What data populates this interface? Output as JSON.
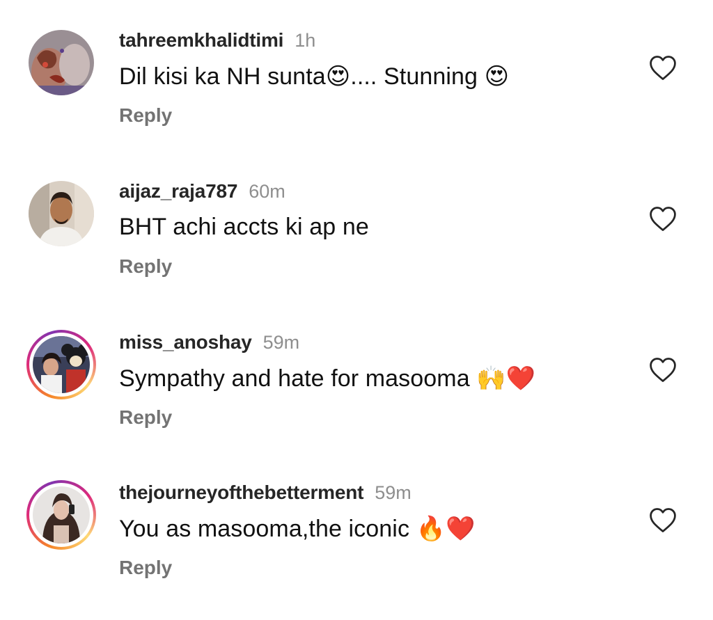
{
  "comments": [
    {
      "username": "tahreemkhalidtimi",
      "time": "1h",
      "text": "Dil kisi ka NH sunta😍.... Stunning 😍",
      "reply_label": "Reply",
      "avatar_icon": "profile-photo",
      "has_story_ring": false
    },
    {
      "username": "aijaz_raja787",
      "time": "60m",
      "text": "BHT achi accts ki ap ne",
      "reply_label": "Reply",
      "avatar_icon": "profile-photo",
      "has_story_ring": false
    },
    {
      "username": "miss_anoshay",
      "time": "59m",
      "text": "Sympathy and hate for masooma 🙌❤️",
      "reply_label": "Reply",
      "avatar_icon": "profile-photo",
      "has_story_ring": true
    },
    {
      "username": "thejourneyofthebetterment",
      "time": "59m",
      "text": "You as masooma,the iconic 🔥❤️",
      "reply_label": "Reply",
      "avatar_icon": "profile-photo",
      "has_story_ring": true
    }
  ],
  "icons": {
    "like": "heart-outline-icon"
  },
  "colors": {
    "username": "#262626",
    "timestamp": "#8e8e8e",
    "reply": "#737373",
    "story_ring_start": "#f58529",
    "story_ring_end": "#dd2a7b"
  }
}
